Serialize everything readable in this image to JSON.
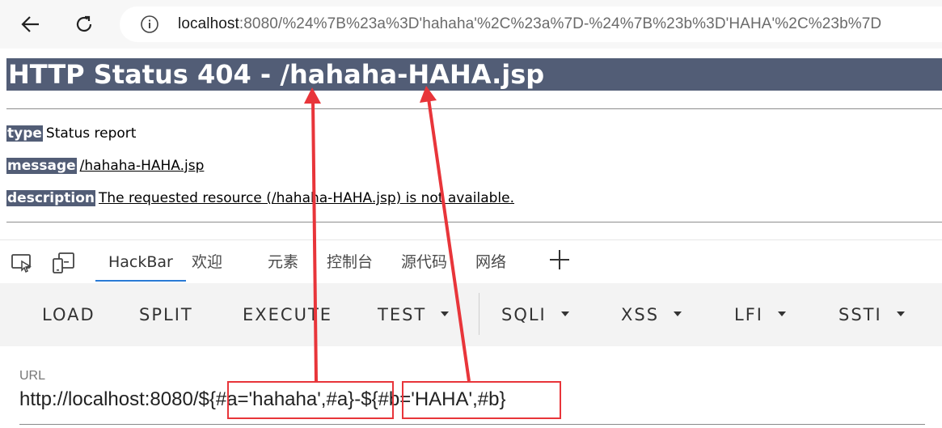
{
  "browser": {
    "url_host": "localhost",
    "url_rest": ":8080/%24%7B%23a%3D'hahaha'%2C%23a%7D-%24%7B%23b%3D'HAHA'%2C%23b%7D"
  },
  "page": {
    "title": "HTTP Status 404 - /hahaha-HAHA.jsp",
    "rows": [
      {
        "label": "type",
        "value": "Status report"
      },
      {
        "label": "message",
        "value": "/hahaha-HAHA.jsp"
      },
      {
        "label": "description",
        "value": "The requested resource (/hahaha-HAHA.jsp) is not available."
      }
    ]
  },
  "devtools": {
    "tabs": [
      "HackBar",
      "欢迎",
      "元素",
      "控制台",
      "源代码",
      "网络"
    ],
    "active_tab": "HackBar"
  },
  "hackbar": {
    "buttons": [
      "LOAD",
      "SPLIT",
      "EXECUTE",
      "TEST",
      "SQLI",
      "XSS",
      "LFI",
      "SSTI"
    ],
    "url_label": "URL",
    "url_prefix": "http://localhost:8080/",
    "url_part_a": "${#a='hahaha',#a}",
    "url_sep": "-",
    "url_part_b": "${#b='HAHA',#b}"
  },
  "colors": {
    "tomcat_header": "#525d76",
    "annotation_red": "#e8353a",
    "active_tab_underline": "#2a7ad5"
  }
}
